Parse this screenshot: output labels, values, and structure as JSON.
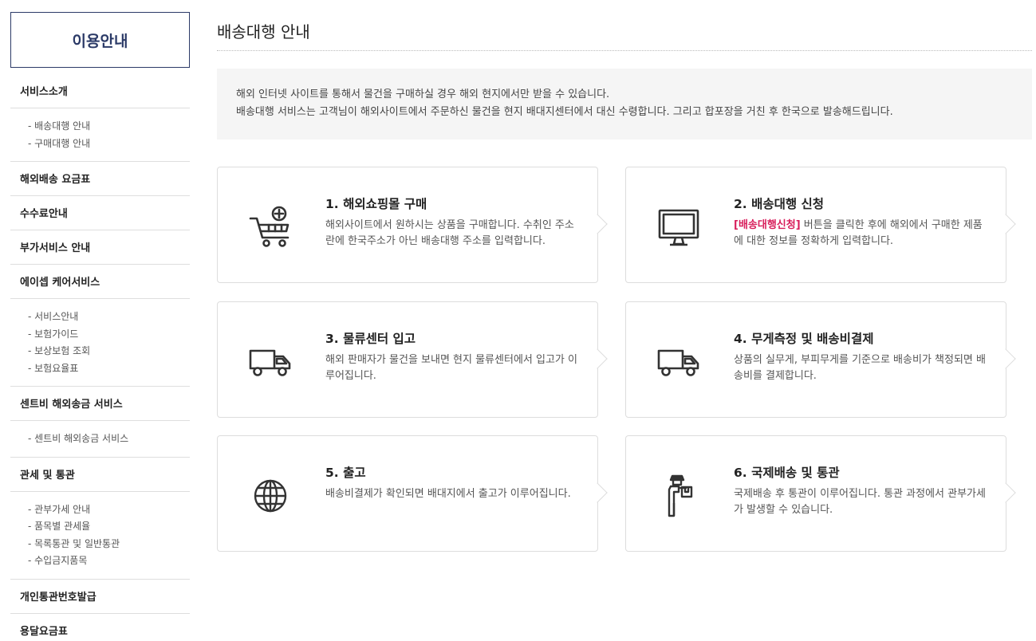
{
  "sidebar": {
    "title": "이용안내",
    "sections": [
      {
        "label": "서비스소개",
        "items": [
          "- 배송대행 안내",
          "- 구매대행 안내"
        ]
      },
      {
        "label": "해외배송 요금표",
        "items": []
      },
      {
        "label": "수수료안내",
        "items": []
      },
      {
        "label": "부가서비스 안내",
        "items": []
      },
      {
        "label": "에이셉 케어서비스",
        "items": [
          "- 서비스안내",
          "- 보험가이드",
          "- 보상보험 조회",
          "- 보험요율표"
        ]
      },
      {
        "label": "센트비 해외송금 서비스",
        "items": [
          "- 센트비 해외송금 서비스"
        ]
      },
      {
        "label": "관세 및 통관",
        "items": [
          "- 관부가세 안내",
          "- 품목별 관세율",
          "- 목록통관 및 일반통관",
          "- 수입금지품목"
        ]
      },
      {
        "label": "개인통관번호발급",
        "items": []
      },
      {
        "label": "용달요금표",
        "items": []
      }
    ]
  },
  "main": {
    "title": "배송대행 안내",
    "intro": [
      "해외 인터넷 사이트를 통해서 물건을 구매하실 경우 해외 현지에서만 받을 수 있습니다.",
      "배송대행 서비스는 고객님이 해외사이트에서 주문하신 물건을 현지 배대지센터에서 대신 수령합니다. 그리고 합포장을 거친 후 한국으로 발송해드립니다."
    ],
    "steps": [
      {
        "title": "1. 해외쇼핑몰 구매",
        "icon": "cart-icon",
        "highlight": "",
        "desc": "해외사이트에서 원하시는 상품을 구매합니다. 수취인 주소란에 한국주소가 아닌 배송대행 주소를 입력합니다."
      },
      {
        "title": "2. 배송대행 신청",
        "icon": "monitor-icon",
        "highlight": "[배송대행신청]",
        "desc": " 버튼을 클릭한 후에 해외에서 구매한 제품에 대한 정보를 정확하게 입력합니다."
      },
      {
        "title": "3. 물류센터 입고",
        "icon": "truck-icon",
        "highlight": "",
        "desc": "해외 판매자가 물건을 보내면 현지 물류센터에서 입고가 이루어집니다."
      },
      {
        "title": "4. 무게측정 및 배송비결제",
        "icon": "truck-icon",
        "highlight": "",
        "desc": "상품의 실무게, 부피무게를 기준으로 배송비가 책정되면 배송비를 결제합니다."
      },
      {
        "title": "5. 출고",
        "icon": "globe-icon",
        "highlight": "",
        "desc": "배송비결제가 확인되면 배대지에서 출고가 이루어집니다."
      },
      {
        "title": "6. 국제배송 및 통관",
        "icon": "delivery-person-icon",
        "highlight": "",
        "desc": "국제배송 후 통관이 이루어집니다. 통관 과정에서 관부가세가 발생할 수 있습니다."
      }
    ]
  },
  "colors": {
    "accent": "#2b3a67",
    "highlight": "#d81e5b",
    "intro_bg": "#f5f5f5",
    "border": "#dddddd"
  }
}
